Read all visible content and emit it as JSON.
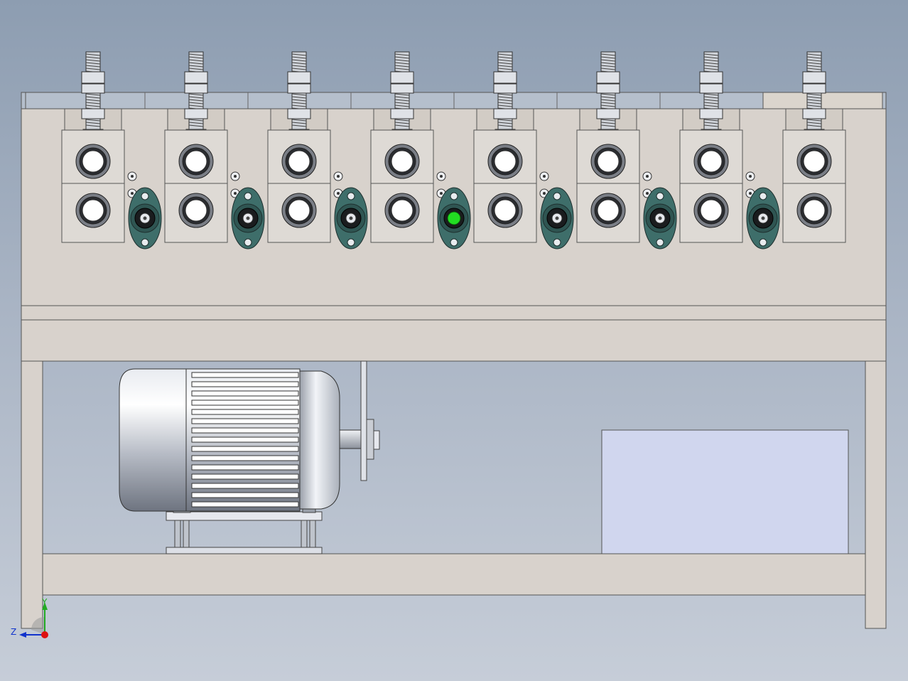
{
  "view": {
    "background_top": "#8d9db1",
    "background_bottom": "#c6cdd8",
    "frame_color": "#d8d2cc",
    "frame_edge_color": "#5a5a5a",
    "top_plate_color": "#b5bfcc",
    "top_plate_light_color": "#dbd5cd",
    "housing_color": "#dedad5",
    "flange_bearing_color": "#3e6e6a",
    "highlight_color": "#22dd22",
    "motor_color": "#c4c8d0",
    "control_box_color": "#d0d6ee"
  },
  "roller_stations": {
    "count": 8,
    "flange_bearing_count": 7,
    "highlighted_bearing_index": 3
  },
  "triad": {
    "y_label": "Y",
    "z_label": "Z",
    "y_color": "#22aa22",
    "z_color": "#1133cc",
    "origin_color": "#dd1111"
  }
}
